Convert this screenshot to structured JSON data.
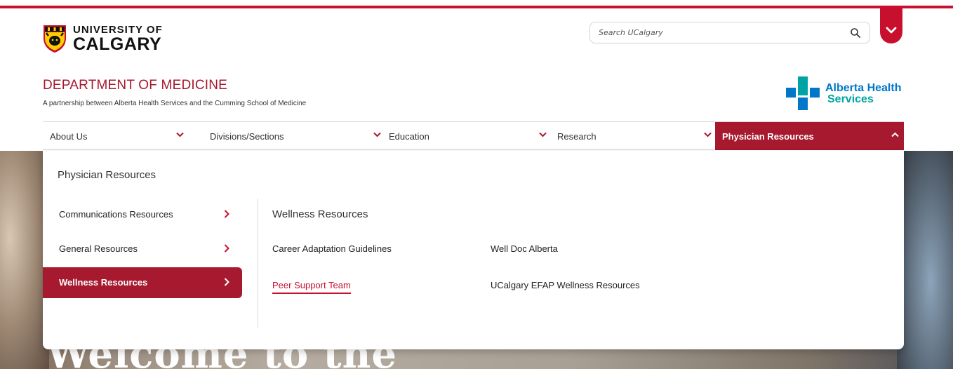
{
  "brand": {
    "logo_line1": "UNIVERSITY OF",
    "logo_line2": "CALGARY",
    "accent_color": "#c8102e",
    "crest_icon": "university-crest-icon"
  },
  "search": {
    "placeholder": "Search UCalgary",
    "value": "",
    "icon": "search-icon"
  },
  "utility": {
    "toggle_icon": "chevron-down-icon"
  },
  "header": {
    "title": "DEPARTMENT OF MEDICINE",
    "subtitle": "A partnership between Alberta Health Services and the Cumming School of Medicine",
    "title_color": "#a6192e"
  },
  "partner_logo": {
    "line1": "Alberta Health",
    "line2": "Services",
    "icon": "ahs-cross-icon"
  },
  "nav": {
    "items": [
      {
        "label": "About Us",
        "expanded": false
      },
      {
        "label": "Divisions/Sections",
        "expanded": false
      },
      {
        "label": "Education",
        "expanded": false
      },
      {
        "label": "Research",
        "expanded": false
      },
      {
        "label": "Physician Resources",
        "expanded": true
      }
    ]
  },
  "mega_menu": {
    "title": "Physician Resources",
    "side_items": [
      {
        "label": "Communications Resources",
        "active": false
      },
      {
        "label": "General Resources",
        "active": false
      },
      {
        "label": "Wellness Resources",
        "active": true
      }
    ],
    "panel_title": "Wellness Resources",
    "links": [
      {
        "label": "Career Adaptation Guidelines",
        "highlighted": false
      },
      {
        "label": "Well Doc Alberta",
        "highlighted": false
      },
      {
        "label": "Peer Support Team",
        "highlighted": true
      },
      {
        "label": "UCalgary EFAP Wellness Resources",
        "highlighted": false
      }
    ]
  },
  "hero": {
    "heading_fragment": "Welcome to the"
  }
}
